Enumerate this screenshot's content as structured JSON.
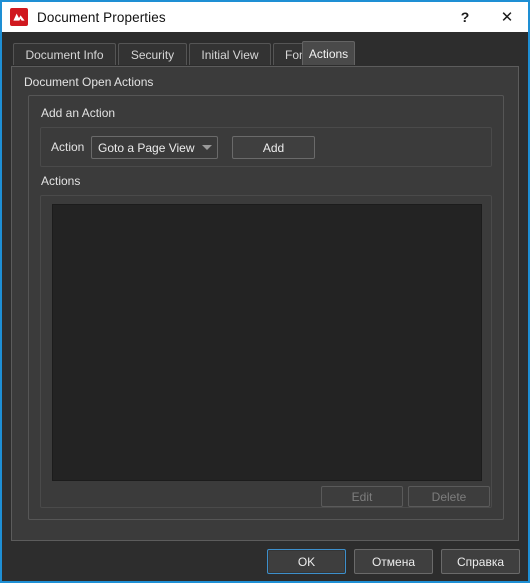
{
  "window": {
    "title": "Document Properties",
    "icon": "pdf-app-icon",
    "accent_color": "#1e8fd4",
    "titlebar_background": "#ffffff",
    "body_background": "#2d2d2d"
  },
  "titlebar_buttons": {
    "help": "?",
    "close": "✕"
  },
  "tabs": [
    {
      "label": "Document Info",
      "active": false
    },
    {
      "label": "Security",
      "active": false
    },
    {
      "label": "Initial View",
      "active": false
    },
    {
      "label": "Fonts",
      "active": false
    },
    {
      "label": "Actions",
      "active": true
    }
  ],
  "page": {
    "section_title": "Document Open Actions",
    "group_label": "Add an Action",
    "action_field": {
      "label": "Action",
      "value": "Goto a Page View",
      "arrow_icon": "chevron-down-icon"
    },
    "add_button": "Add",
    "actions_label": "Actions",
    "actions_list": [],
    "edit_button": "Edit",
    "delete_button": "Delete",
    "edit_enabled": false,
    "delete_enabled": false
  },
  "footer": {
    "ok": "OK",
    "cancel": "Отмена",
    "help": "Справка"
  }
}
